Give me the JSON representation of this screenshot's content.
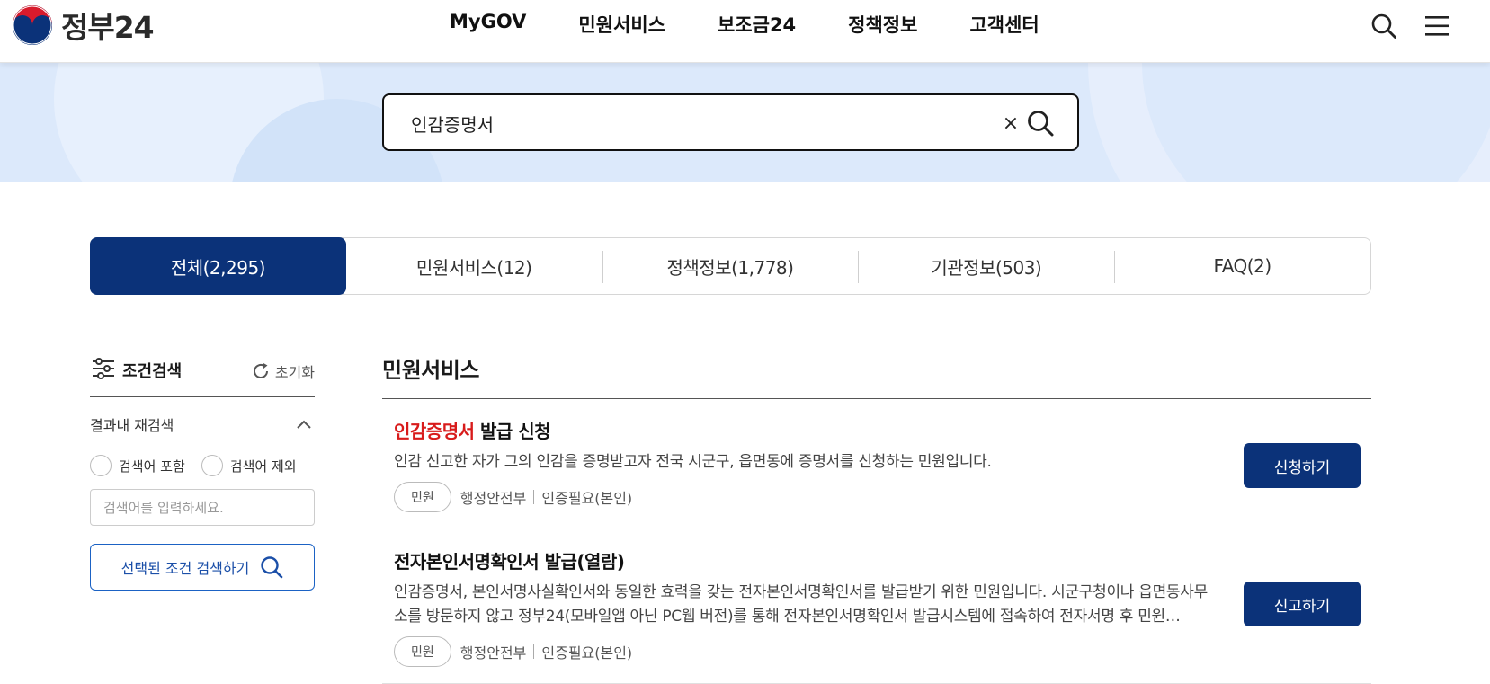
{
  "header": {
    "logo_text": "정부24",
    "nav": [
      "MyGOV",
      "민원서비스",
      "보조금24",
      "정책정보",
      "고객센터"
    ]
  },
  "search": {
    "value": "인감증명서",
    "clear_glyph": "×"
  },
  "tabs": [
    {
      "label": "전체(2,295)",
      "active": true
    },
    {
      "label": "민원서비스(12)",
      "active": false
    },
    {
      "label": "정책정보(1,778)",
      "active": false
    },
    {
      "label": "기관정보(503)",
      "active": false
    },
    {
      "label": "FAQ(2)",
      "active": false
    }
  ],
  "filter": {
    "title": "조건검색",
    "reset_label": "초기화",
    "subsection": "결과내 재검색",
    "radio_include": "검색어 포함",
    "radio_exclude": "검색어 제외",
    "input_placeholder": "검색어를 입력하세요.",
    "button_label": "선택된 조건 검색하기"
  },
  "results": {
    "section_title": "민원서비스",
    "items": [
      {
        "title_highlight": "인감증명서",
        "title_rest": " 발급 신청",
        "description": "인감 신고한 자가 그의 인감을 증명받고자 전국 시군구, 읍면동에 증명서를 신청하는 민원입니다.",
        "badge": "민원",
        "agency": "행정안전부",
        "auth": "인증필요(본인)",
        "button": "신청하기"
      },
      {
        "title": "전자본인서명확인서 발급(열람)",
        "description": "인감증명서, 본인서명사실확인서와 동일한 효력을 갖는 전자본인서명확인서를 발급받기 위한 민원입니다. 시군구청이나 읍면동사무소를 방문하지 않고 정부24(모바일앱 아닌 PC웹 버전)를 통해 전자본인서명확인서 발급시스템에 접속하여 전자서명 후 민원…",
        "badge": "민원",
        "agency": "행정안전부",
        "auth": "인증필요(본인)",
        "button": "신고하기"
      }
    ]
  },
  "colors": {
    "brand_navy": "#0b3279",
    "highlight_red": "#d81b1b",
    "hero_bg": "#dce9fb"
  }
}
